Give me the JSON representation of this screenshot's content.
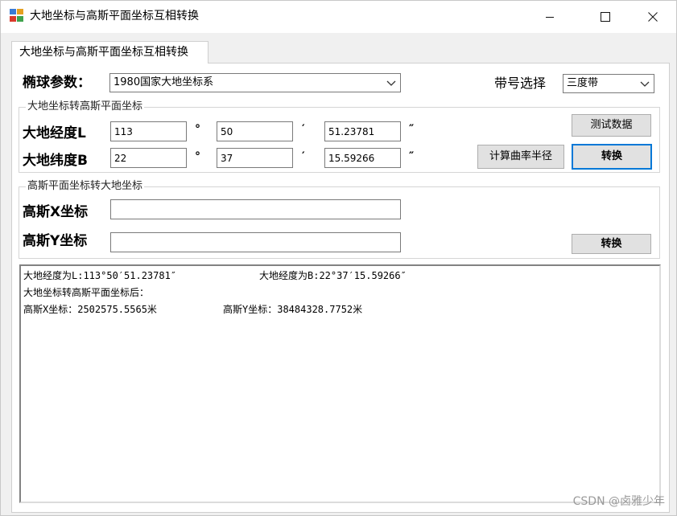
{
  "window": {
    "title": "大地坐标与高斯平面坐标互相转换",
    "minimize": "—",
    "maximize": "☐",
    "close": "✕"
  },
  "tab": {
    "label": "大地坐标与高斯平面坐标互相转换"
  },
  "ellipsoid": {
    "label": "椭球参数：",
    "value": "1980国家大地坐标系"
  },
  "zone": {
    "label": "带号选择",
    "value": "三度带"
  },
  "geo_to_gauss": {
    "title": "大地坐标转高斯平面坐标",
    "lon_label": "大地经度L",
    "lat_label": "大地纬度B",
    "lon_deg": "113",
    "lon_min": "50",
    "lon_sec": "51.23781",
    "lat_deg": "22",
    "lat_min": "37",
    "lat_sec": "15.59266",
    "deg_symbol": "°",
    "min_symbol": "′",
    "sec_symbol": "″",
    "test_data_button": "测试数据",
    "radius_button": "计算曲率半径",
    "convert_button": "转换"
  },
  "gauss_to_geo": {
    "title": "高斯平面坐标转大地坐标",
    "x_label": "高斯X坐标",
    "y_label": "高斯Y坐标",
    "x_value": "",
    "y_value": "",
    "convert_button": "转换"
  },
  "output": {
    "line1_a": "大地经度为L:113°50′51.23781″",
    "line1_b": "大地经度为B:22°37′15.59266″",
    "line2": "大地坐标转高斯平面坐标后：",
    "line3_a": "高斯X坐标：2502575.5565米",
    "line3_b": "高斯Y坐标：38484328.7752米"
  },
  "watermark": "CSDN @卤雅少年"
}
